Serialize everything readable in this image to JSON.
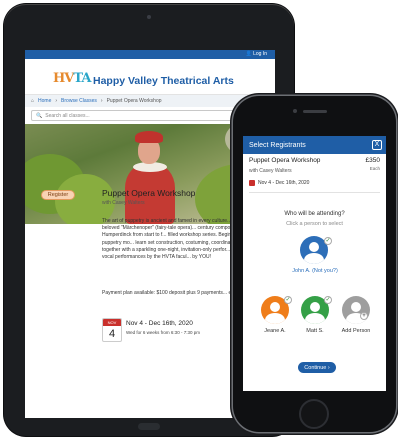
{
  "tablet": {
    "topbar": {
      "login": "Log In"
    },
    "header": {
      "logo_text": "HVTA",
      "brand": "Happy Valley Theatrical Arts"
    },
    "breadcrumb": [
      "Home",
      "Browse Classes",
      "Puppet Opera Workshop"
    ],
    "search": {
      "placeholder": "Search all classes..."
    },
    "course": {
      "register_label": "Register",
      "title": "Puppet Opera Workshop",
      "with": "with  Casey Walters",
      "description": "The art of puppetry is ancient and famed in every culture... experience the beloved \"Märchenoper\" (fairy-tale opera)... century composer Engelbert Humperdinck from start to f... filled workshop series. Beginning with basic puppetry mo... learn set construction, costuming, coordination, and ensi... together with a sparkling one-night, invitation-only perfor... filled opera with vocal performances by the HVTA facul... by YOU!",
      "plan": "Payment plan available: $100 deposit plus 9 payments... every four weeks.",
      "cal_month": "NOV",
      "cal_day": "4",
      "dates": "Nov 4 - Dec 16th, 2020",
      "days": "Wed for 6 weeks from 6:30 - 7:30 pm"
    }
  },
  "phone": {
    "header": {
      "title": "Select Registrants",
      "close": "X"
    },
    "course": {
      "title": "Puppet Opera Workshop",
      "price": "£350",
      "price_unit": "Each",
      "with": "with  Casey Walters",
      "dates": "Nov 4 - Dec 16th, 2020"
    },
    "question": "Who will be attending?",
    "hint": "Click a person to select",
    "people": [
      {
        "name": "John A. (Not you?)",
        "color": "#2d6eb8"
      },
      {
        "name": "Jeane A.",
        "color": "#ef7d1a"
      },
      {
        "name": "Matt S.",
        "color": "#35a047"
      },
      {
        "name": "Add Person",
        "color": "#9e9e9e"
      }
    ],
    "continue_label": "Continue"
  }
}
